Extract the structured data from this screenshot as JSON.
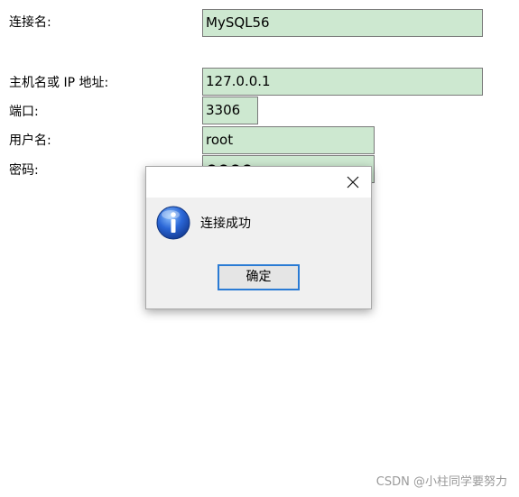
{
  "form": {
    "conn_name_label": "连接名:",
    "conn_name_value": "MySQL56",
    "host_label": "主机名或 IP 地址:",
    "host_value": "127.0.0.1",
    "port_label": "端口:",
    "port_value": "3306",
    "user_label": "用户名:",
    "user_value": "root",
    "password_label": "密码:",
    "password_value": "●●●●"
  },
  "dialog": {
    "close_icon": "close-icon",
    "info_icon": "info-icon",
    "message": "连接成功",
    "ok_label": "确定"
  },
  "watermark": "CSDN @小柱同学要努力",
  "colors": {
    "field_bg": "#cde8d0",
    "button_focus_border": "#2a7bd4",
    "dialog_bg": "#f0f0f0"
  }
}
